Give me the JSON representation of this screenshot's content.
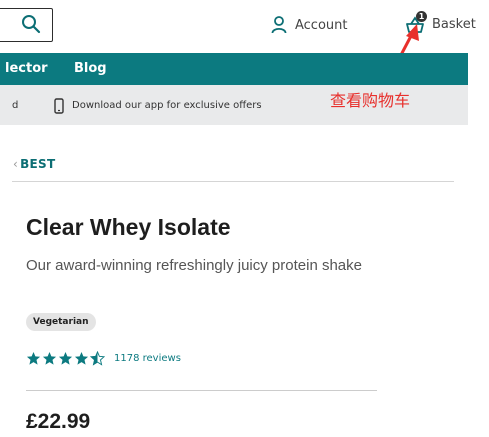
{
  "header": {
    "search_icon": "search-icon",
    "account_label": "Account",
    "account_icon": "user-icon",
    "basket_label": "Basket",
    "basket_icon": "basket-icon",
    "basket_count": "1"
  },
  "nav": {
    "items": [
      {
        "label": "lector"
      },
      {
        "label": "Blog"
      }
    ]
  },
  "promo": {
    "partial": "d",
    "text": "Download our app for exclusive offers",
    "icon": "phone-icon"
  },
  "annotation": {
    "text": "查看购物车",
    "color": "#e8302c"
  },
  "breadcrumb": {
    "text": "BEST"
  },
  "product": {
    "title": "Clear Whey Isolate",
    "description": "Our award-winning refreshingly juicy protein shake",
    "tag": "Vegetarian",
    "rating": 4.5,
    "reviews": "1178 reviews",
    "price": "£22.99"
  },
  "colors": {
    "brand": "#0c7a80",
    "promo_bg": "#e9eaeb",
    "annotation": "#e8302c"
  }
}
